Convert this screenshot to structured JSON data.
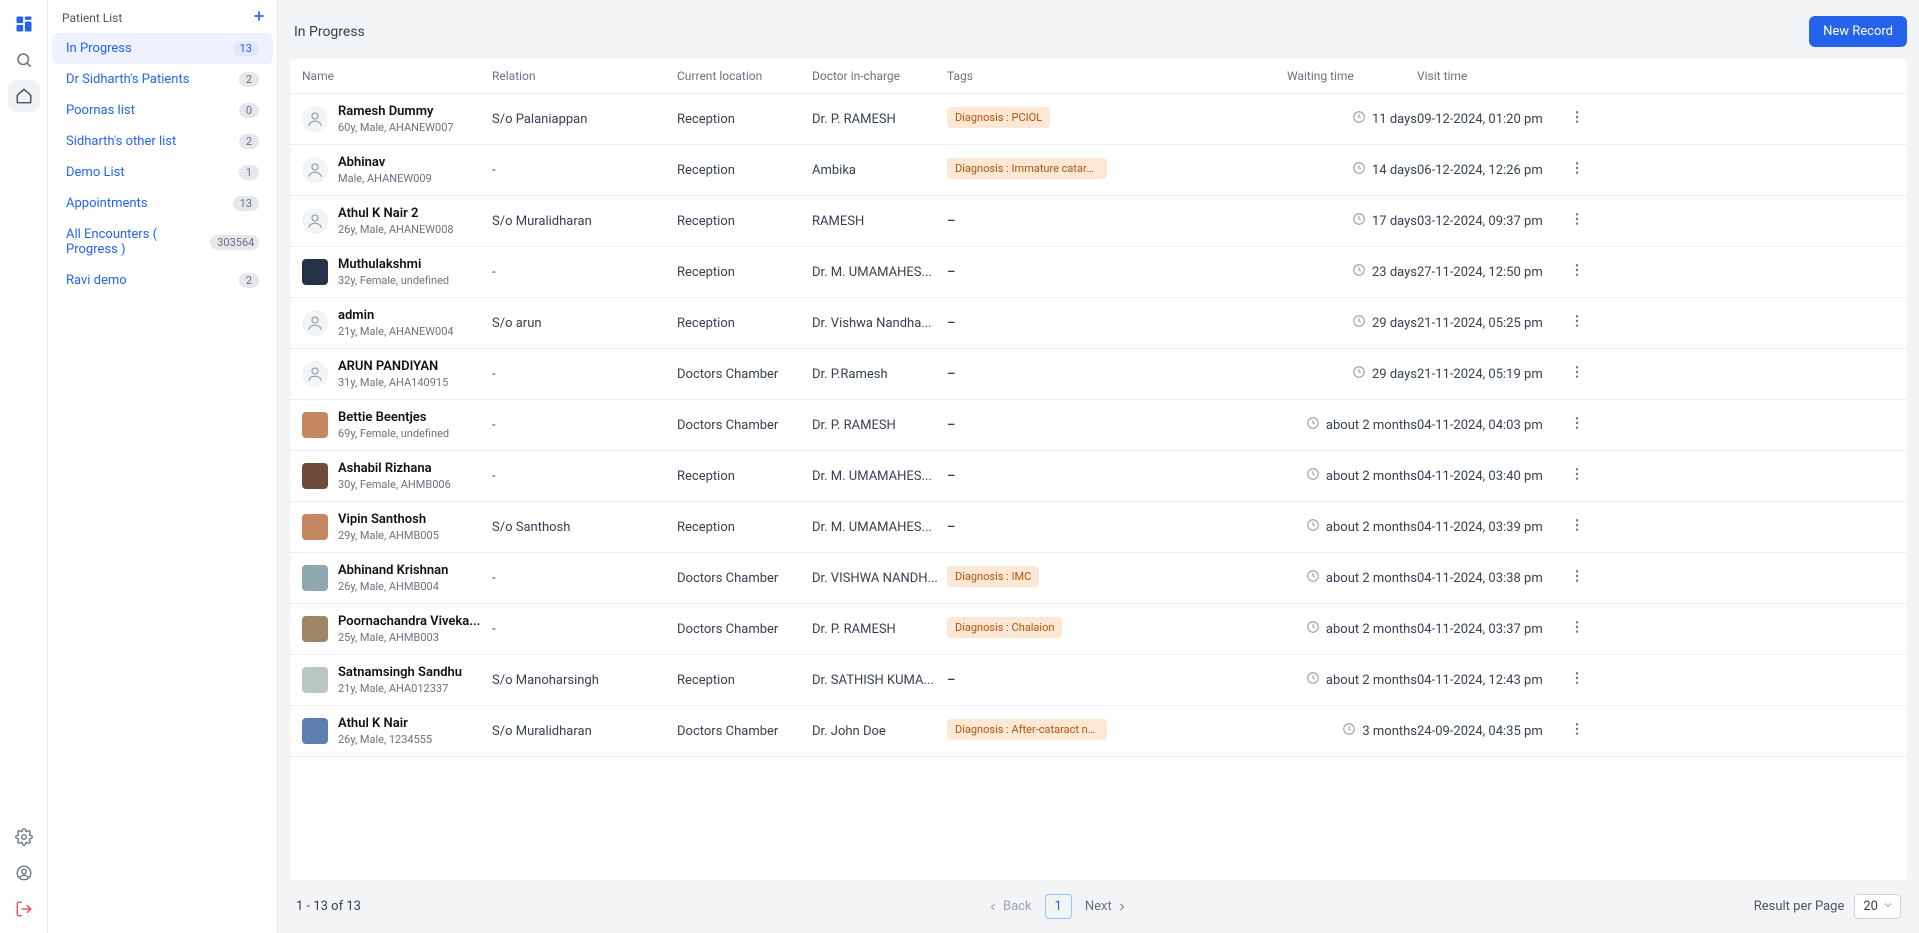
{
  "rail": {
    "dashboard": "dashboard",
    "search": "search",
    "home": "home",
    "settings": "settings",
    "profile": "profile",
    "logout": "logout"
  },
  "sidebar": {
    "title": "Patient List",
    "items": [
      {
        "label": "In Progress",
        "count": "13",
        "active": true
      },
      {
        "label": "Dr Sidharth's Patients",
        "count": "2",
        "active": false
      },
      {
        "label": "Poornas list",
        "count": "0",
        "active": false
      },
      {
        "label": "Sidharth's other list",
        "count": "2",
        "active": false
      },
      {
        "label": "Demo List",
        "count": "1",
        "active": false
      },
      {
        "label": "Appointments",
        "count": "13",
        "active": false
      },
      {
        "label": "All Encounters ( Progress )",
        "count": "303564",
        "active": false
      },
      {
        "label": "Ravi demo",
        "count": "2",
        "active": false
      }
    ]
  },
  "header": {
    "title": "In Progress",
    "new_record": "New Record"
  },
  "columns": {
    "name": "Name",
    "relation": "Relation",
    "location": "Current location",
    "doctor": "Doctor in-charge",
    "tags": "Tags",
    "waiting": "Waiting time",
    "visit": "Visit time"
  },
  "rows": [
    {
      "name": "Ramesh Dummy",
      "meta": "60y, Male, AHANEW007",
      "avatar": "placeholder",
      "relation": "S/o Palaniappan",
      "location": "Reception",
      "doctor": "Dr. P. RAMESH",
      "tag": "Diagnosis : PCIOL",
      "waiting": "11 days",
      "visit": "09-12-2024, 01:20 pm"
    },
    {
      "name": "Abhinav",
      "meta": "Male, AHANEW009",
      "avatar": "placeholder",
      "relation": "-",
      "location": "Reception",
      "doctor": "Ambika",
      "tag": "Diagnosis : Immature cataract ...",
      "waiting": "14 days",
      "visit": "06-12-2024, 12:26 pm"
    },
    {
      "name": "Athul K Nair 2",
      "meta": "26y, Male, AHANEW008",
      "avatar": "placeholder",
      "relation": "S/o Muralidharan",
      "location": "Reception",
      "doctor": "RAMESH",
      "tag": "–",
      "waiting": "17 days",
      "visit": "03-12-2024, 09:37 pm"
    },
    {
      "name": "Muthulakshmi",
      "meta": "32y, Female, undefined",
      "avatar": "color-1",
      "relation": "-",
      "location": "Reception",
      "doctor": "Dr. M. UMAMAHES...",
      "tag": "–",
      "waiting": "23 days",
      "visit": "27-11-2024, 12:50 pm"
    },
    {
      "name": "admin",
      "meta": "21y, Male, AHANEW004",
      "avatar": "placeholder",
      "relation": "S/o arun",
      "location": "Reception",
      "doctor": "Dr. Vishwa Nandha...",
      "tag": "–",
      "waiting": "29 days",
      "visit": "21-11-2024, 05:25 pm"
    },
    {
      "name": "ARUN PANDIYAN",
      "meta": "31y, Male, AHA140915",
      "avatar": "placeholder",
      "relation": "-",
      "location": "Doctors Chamber",
      "doctor": "Dr. P.Ramesh",
      "tag": "–",
      "waiting": "29 days",
      "visit": "21-11-2024, 05:19 pm"
    },
    {
      "name": "Bettie Beentjes",
      "meta": "69y, Female, undefined",
      "avatar": "color-2",
      "relation": "-",
      "location": "Doctors Chamber",
      "doctor": "Dr. P. RAMESH",
      "tag": "–",
      "waiting": "about 2 months",
      "visit": "04-11-2024, 04:03 pm"
    },
    {
      "name": "Ashabil Rizhana",
      "meta": "30y, Female, AHMB006",
      "avatar": "color-3",
      "relation": "-",
      "location": "Reception",
      "doctor": "Dr. M. UMAMAHES...",
      "tag": "–",
      "waiting": "about 2 months",
      "visit": "04-11-2024, 03:40 pm"
    },
    {
      "name": "Vipin Santhosh",
      "meta": "29y, Male, AHMB005",
      "avatar": "color-2",
      "relation": "S/o Santhosh",
      "location": "Reception",
      "doctor": "Dr. M. UMAMAHES...",
      "tag": "–",
      "waiting": "about 2 months",
      "visit": "04-11-2024, 03:39 pm"
    },
    {
      "name": "Abhinand Krishnan",
      "meta": "26y, Male, AHMB004",
      "avatar": "color-4",
      "relation": "-",
      "location": "Doctors Chamber",
      "doctor": "Dr. VISHWA NANDH...",
      "tag": "Diagnosis : IMC",
      "waiting": "about 2 months",
      "visit": "04-11-2024, 03:38 pm"
    },
    {
      "name": "Poornachandra Viveka...",
      "meta": "25y, Male, AHMB003",
      "avatar": "color-5",
      "relation": "-",
      "location": "Doctors Chamber",
      "doctor": "Dr. P. RAMESH",
      "tag": "Diagnosis : Chalaion",
      "waiting": "about 2 months",
      "visit": "04-11-2024, 03:37 pm"
    },
    {
      "name": "Satnamsingh Sandhu",
      "meta": "21y, Male, AHA012337",
      "avatar": "color-6",
      "relation": "S/o Manoharsingh",
      "location": "Reception",
      "doctor": "Dr. SATHISH KUMA...",
      "tag": "–",
      "waiting": "about 2 months",
      "visit": "04-11-2024, 12:43 pm"
    },
    {
      "name": "Athul K Nair",
      "meta": "26y, Male, 1234555",
      "avatar": "color-7",
      "relation": "S/o Muralidharan",
      "location": "Doctors Chamber",
      "doctor": "Dr. John Doe",
      "tag": "Diagnosis : After-cataract not...",
      "waiting": "3 months",
      "visit": "24-09-2024, 04:35 pm"
    }
  ],
  "footer": {
    "range": "1 - 13 of 13",
    "back": "Back",
    "page": "1",
    "next": "Next",
    "rpp_label": "Result per Page",
    "rpp_value": "20"
  }
}
